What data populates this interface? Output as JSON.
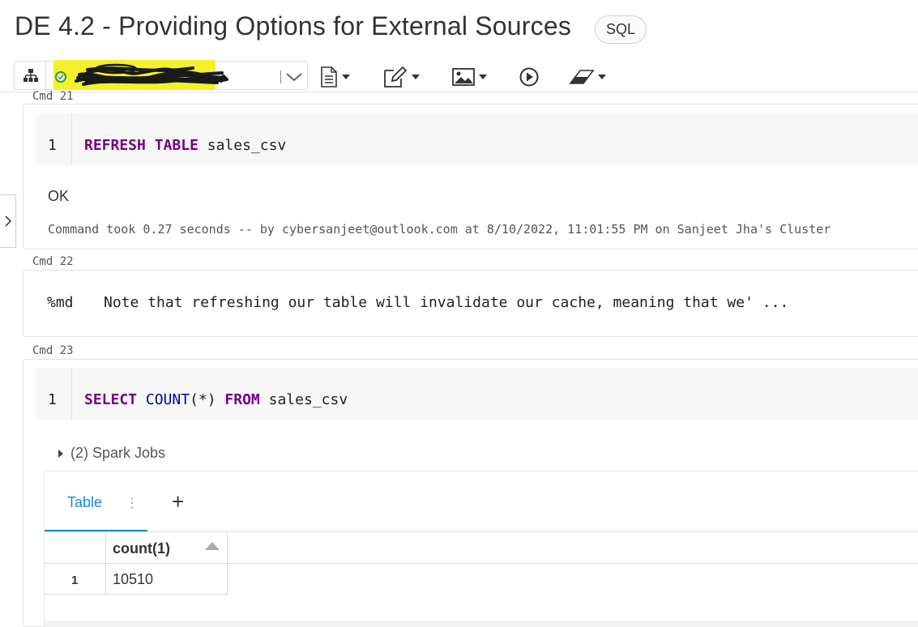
{
  "notebook": {
    "title": "DE 4.2 - Providing Options for External Sources",
    "language_badge": "SQL"
  },
  "toolbar": {
    "schema_icon": "sitemap-icon",
    "cluster_status": "running",
    "cluster_name_redacted": true,
    "tools": [
      {
        "name": "file-icon",
        "has_dropdown": true
      },
      {
        "name": "edit-icon",
        "has_dropdown": true
      },
      {
        "name": "image-icon",
        "has_dropdown": true
      },
      {
        "name": "play-circle-icon",
        "has_dropdown": false
      },
      {
        "name": "eraser-icon",
        "has_dropdown": true
      }
    ]
  },
  "cells": {
    "cmd21": {
      "label": "Cmd 21",
      "line_number": "1",
      "code_kw1": "REFRESH",
      "code_kw2": "TABLE",
      "code_rest": "sales_csv",
      "result": "OK",
      "info": "Command took 0.27 seconds -- by cybersanjeet@outlook.com at 8/10/2022, 11:01:55 PM on Sanjeet Jha's Cluster"
    },
    "cmd22": {
      "label": "Cmd 22",
      "prefix": "%md",
      "text": "Note that refreshing our table will invalidate our cache, meaning that we' ..."
    },
    "cmd23": {
      "label": "Cmd 23",
      "line_number": "1",
      "kw_select": "SELECT",
      "fn_count": "COUNT",
      "paren": "(*)",
      "kw_from": "FROM",
      "table": "sales_csv",
      "spark_jobs": "(2) Spark Jobs",
      "results": {
        "tab_label": "Table",
        "kebab": "⋮",
        "add": "+",
        "columns": [
          "count(1)"
        ],
        "rows": [
          {
            "index": "1",
            "values": [
              "10510"
            ]
          }
        ]
      }
    }
  }
}
